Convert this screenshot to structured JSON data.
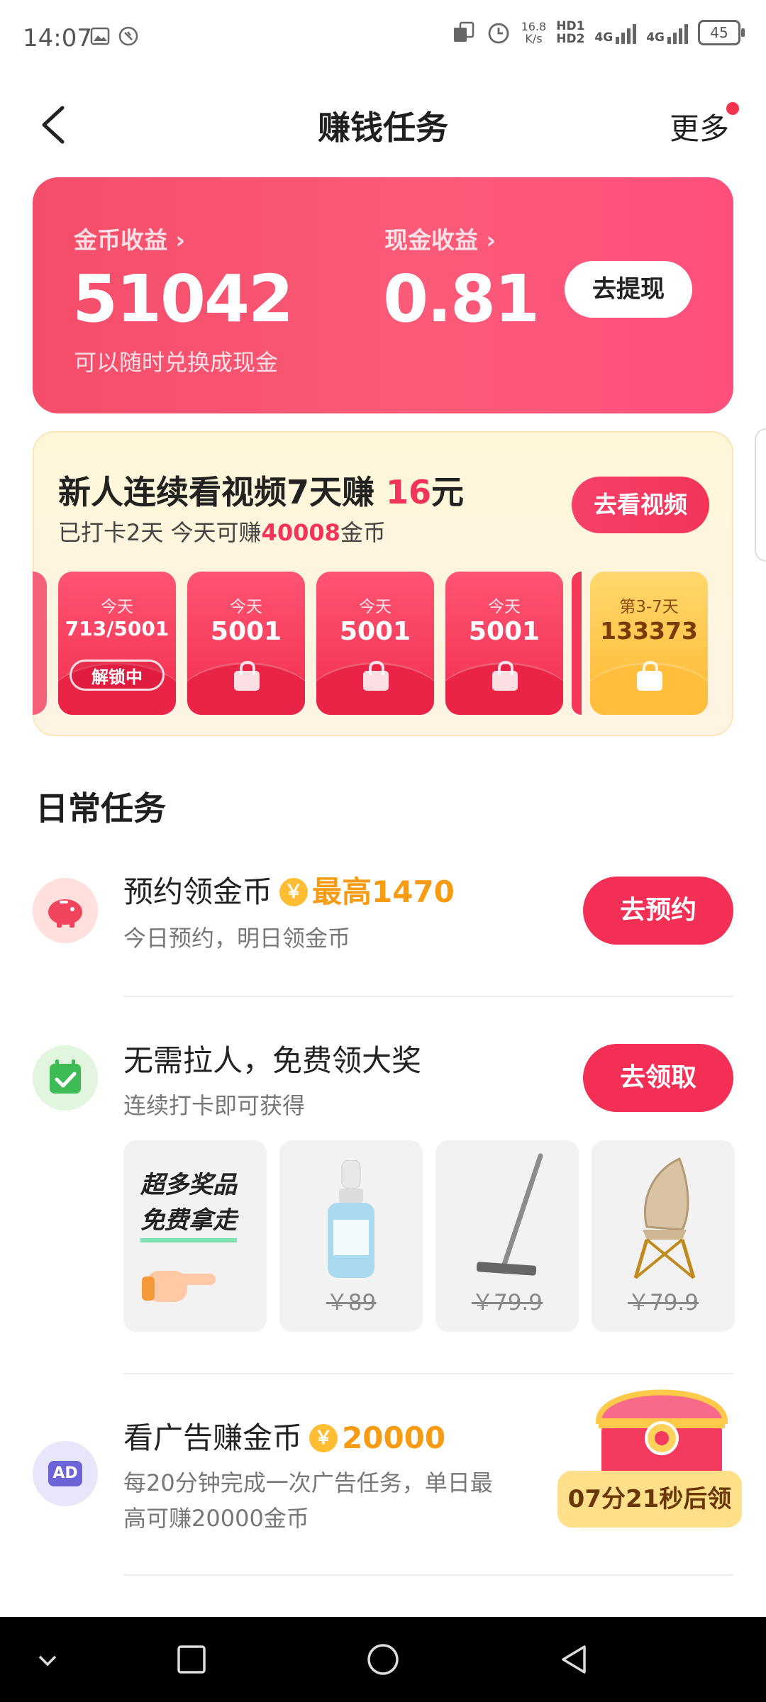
{
  "status_bar": {
    "time": "14:07",
    "net_speed": "16.8",
    "net_unit": "K/s",
    "hd1": "HD1",
    "hd2": "HD2",
    "sim1": "4G",
    "sim2": "4G",
    "battery": "45"
  },
  "header": {
    "title": "赚钱任务",
    "more": "更多"
  },
  "earnings": {
    "coin_label": "金币收益 ›",
    "coin_value": "51042",
    "cash_label": "现金收益 ›",
    "cash_value": "0.81",
    "subtitle": "可以随时兑换成现金",
    "withdraw_btn": "去提现"
  },
  "checkin": {
    "title_prefix": "新人连续看视频7天赚 ",
    "title_amount": "16",
    "title_suffix": "元",
    "sub_prefix": "已打卡2天 今天可赚",
    "sub_amount": "40008",
    "sub_suffix": "金币",
    "watch_btn": "去看视频",
    "envelopes": [
      {
        "caption": "今天",
        "amount": "713/5001",
        "badge": "解锁中"
      },
      {
        "caption": "今天",
        "amount": "5001"
      },
      {
        "caption": "今天",
        "amount": "5001"
      },
      {
        "caption": "今天",
        "amount": "5001"
      },
      {
        "caption": "第3-7天",
        "amount": "133373"
      }
    ]
  },
  "daily": {
    "title": "日常任务",
    "tasks": [
      {
        "title": "预约领金币",
        "reward": "最高1470",
        "desc": "今日预约，明日领金币",
        "button": "去预约"
      },
      {
        "title": "无需拉人，免费领大奖",
        "desc": "连续打卡即可获得",
        "button": "去领取",
        "prizes": [
          {
            "promo_line1": "超多奖品",
            "promo_line2": "免费拿走"
          },
          {
            "price": "￥89"
          },
          {
            "price": "￥79.9"
          },
          {
            "price": "￥79.9"
          }
        ]
      },
      {
        "title": "看广告赚金币",
        "reward": "20000",
        "desc_line1": "每20分钟完成一次广告任务，单日最",
        "desc_line2": "高可赚20000金币",
        "timer": "07分21秒后领",
        "icon_text": "AD"
      }
    ]
  },
  "coin_symbol": "￥",
  "colors": {
    "accent": "#f42f55",
    "coin": "#ffbd33",
    "reward": "#f79b12"
  }
}
